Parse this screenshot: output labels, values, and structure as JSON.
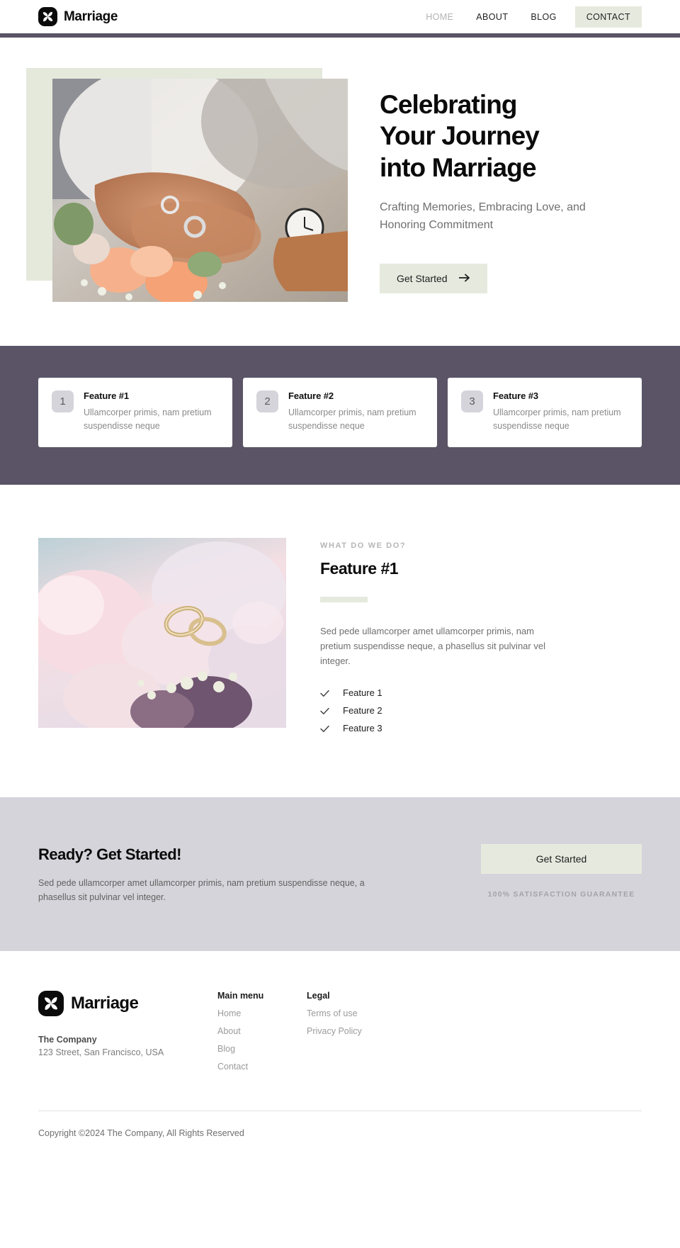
{
  "brand": {
    "name": "Marriage",
    "logo_icon": "pinwheel-logo-icon"
  },
  "nav": {
    "links": [
      {
        "label": "HOME",
        "active": true
      },
      {
        "label": "ABOUT",
        "active": false
      },
      {
        "label": "BLOG",
        "active": false
      }
    ],
    "cta_label": "CONTACT"
  },
  "hero": {
    "title_lines": [
      "Celebrating",
      "Your Journey",
      "into Marriage"
    ],
    "subtitle": "Crafting Memories, Embracing Love, and Honoring Commitment",
    "button_label": "Get Started",
    "button_icon": "arrow-right-icon",
    "image_alt": "wedding-couple-hands-rings-photo"
  },
  "features_strip": {
    "cards": [
      {
        "number": "1",
        "title": "Feature #1",
        "text": "Ullamcorper primis, nam pretium suspendisse neque"
      },
      {
        "number": "2",
        "title": "Feature #2",
        "text": "Ullamcorper primis, nam pretium suspendisse neque"
      },
      {
        "number": "3",
        "title": "Feature #3",
        "text": "Ullamcorper primis, nam pretium suspendisse neque"
      }
    ]
  },
  "detail": {
    "eyebrow": "WHAT DO WE DO?",
    "title": "Feature #1",
    "text": "Sed pede ullamcorper amet ullamcorper primis, nam pretium suspendisse neque, a phasellus sit pulvinar vel integer.",
    "checklist": [
      "Feature 1",
      "Feature 2",
      "Feature 3"
    ],
    "check_icon": "check-icon",
    "image_alt": "wedding-rings-on-bouquet-photo"
  },
  "cta": {
    "title": "Ready? Get Started!",
    "text": "Sed pede ullamcorper amet ullamcorper primis, nam pretium suspendisse neque, a phasellus sit pulvinar vel integer.",
    "button_label": "Get Started",
    "guarantee": "100% SATISFACTION GUARANTEE"
  },
  "footer": {
    "company_label": "The Company",
    "address": "123 Street, San Francisco, USA",
    "columns": [
      {
        "title": "Main menu",
        "links": [
          "Home",
          "About",
          "Blog",
          "Contact"
        ]
      },
      {
        "title": "Legal",
        "links": [
          "Terms of use",
          "Privacy Policy"
        ]
      }
    ],
    "copyright": "Copyright ©2024 The Company, All Rights Reserved"
  },
  "colors": {
    "accent_sage": "#e6eade",
    "band_purple": "#5a5466",
    "cta_gray": "#d5d4da",
    "text_dark": "#0b0b0b",
    "text_muted": "#6f6f6f"
  }
}
